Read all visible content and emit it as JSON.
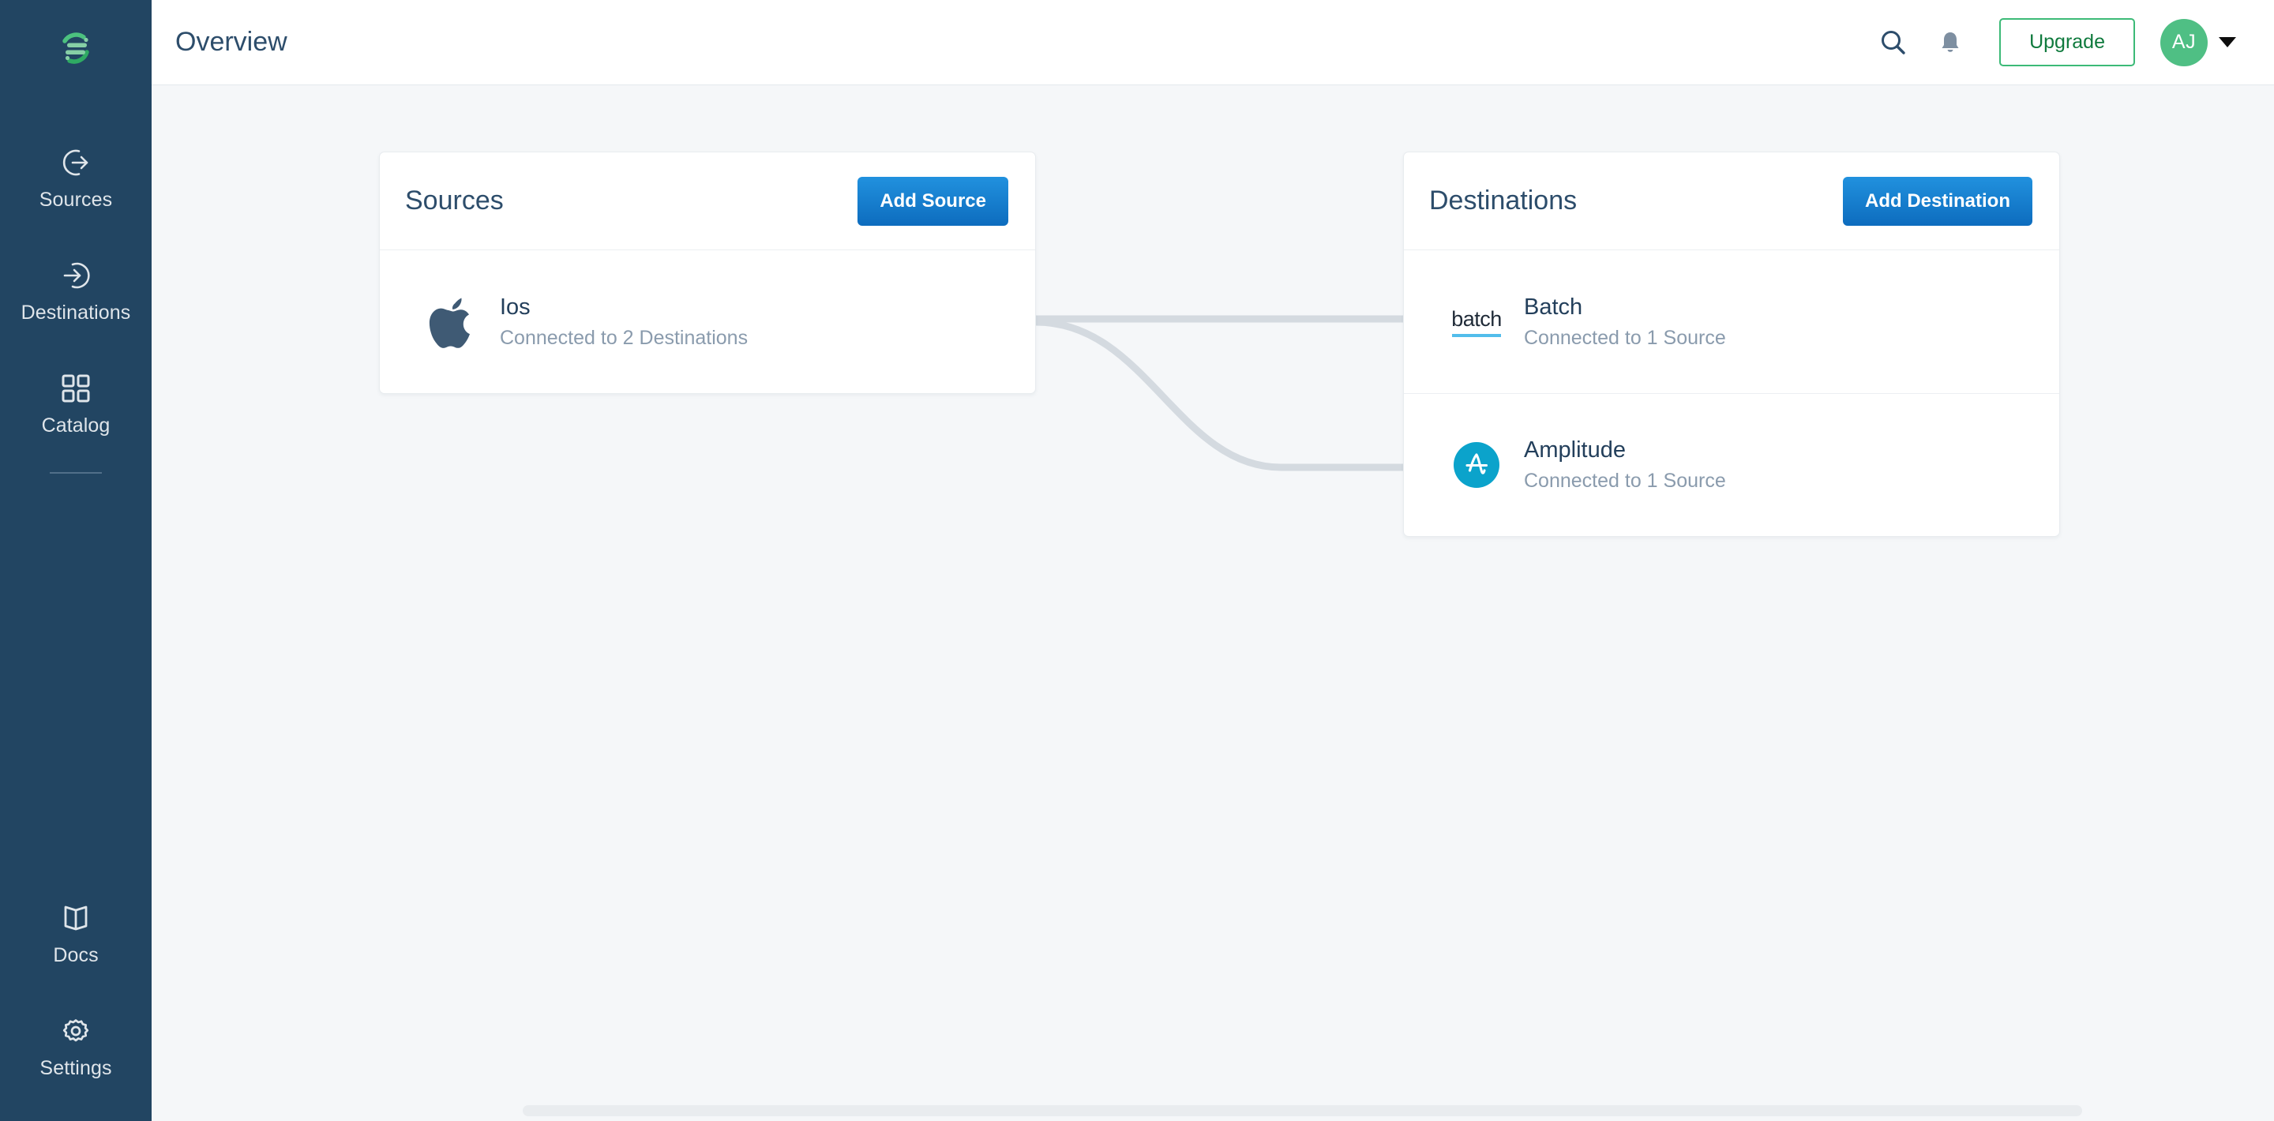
{
  "sidebar": {
    "logo": "stitch-logo-icon",
    "items": [
      {
        "label": "Sources",
        "icon": "arrow-out-circle-icon"
      },
      {
        "label": "Destinations",
        "icon": "arrow-in-circle-icon"
      },
      {
        "label": "Catalog",
        "icon": "grid-squares-icon"
      }
    ],
    "bottom_items": [
      {
        "label": "Docs",
        "icon": "book-icon"
      },
      {
        "label": "Settings",
        "icon": "gear-icon"
      }
    ]
  },
  "header": {
    "title": "Overview",
    "search_icon": "search-icon",
    "notifications_icon": "bell-icon",
    "upgrade_label": "Upgrade",
    "avatar_initials": "AJ",
    "caret_icon": "chevron-down-icon"
  },
  "sources_card": {
    "title": "Sources",
    "add_button": "Add Source",
    "rows": [
      {
        "name": "Ios",
        "subtitle": "Connected to 2 Destinations",
        "icon": "apple-icon"
      }
    ]
  },
  "destinations_card": {
    "title": "Destinations",
    "add_button": "Add Destination",
    "rows": [
      {
        "name": "Batch",
        "subtitle": "Connected to 1 Source",
        "icon": "batch-logo-icon"
      },
      {
        "name": "Amplitude",
        "subtitle": "Connected to 1 Source",
        "icon": "amplitude-icon"
      }
    ]
  },
  "colors": {
    "sidebar_bg": "#224562",
    "accent_blue": "#1479cd",
    "upgrade_green": "#3cba77",
    "avatar_green": "#4fbf84",
    "amplitude_cyan": "#0ba3cb",
    "batch_underline": "#52bdeb",
    "connector": "#d4dae0",
    "text_dark": "#2d4d6b",
    "text_muted": "#8a9bad"
  }
}
